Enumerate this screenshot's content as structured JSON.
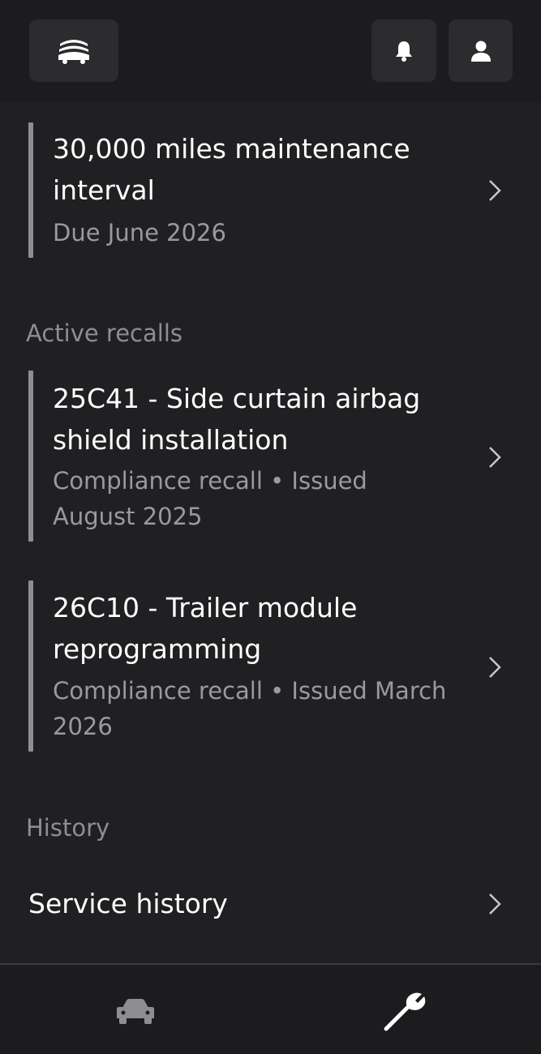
{
  "header": {
    "logo_icon": "vehicle-logo-icon",
    "bell_icon": "bell-icon",
    "user_icon": "user-icon"
  },
  "maintenance": {
    "title": "30,000 miles maintenance interval",
    "subtitle": "Due June 2026"
  },
  "recalls": {
    "section_label": "Active recalls",
    "items": [
      {
        "title": "25C41 - Side curtain airbag shield installation",
        "subtitle": "Compliance recall • Issued August 2025"
      },
      {
        "title": "26C10 - Trailer module reprogramming",
        "subtitle": "Compliance recall • Issued March 2026"
      }
    ]
  },
  "history": {
    "section_label": "History",
    "service_history_label": "Service history"
  },
  "bottom_nav": {
    "items": [
      {
        "icon": "car-icon",
        "active": false
      },
      {
        "icon": "wrench-icon",
        "active": true
      }
    ]
  },
  "colors": {
    "background": "#202022",
    "bar": "#8e8e92",
    "text_secondary": "#9a9a9e",
    "button_bg": "#2c2c2e"
  }
}
